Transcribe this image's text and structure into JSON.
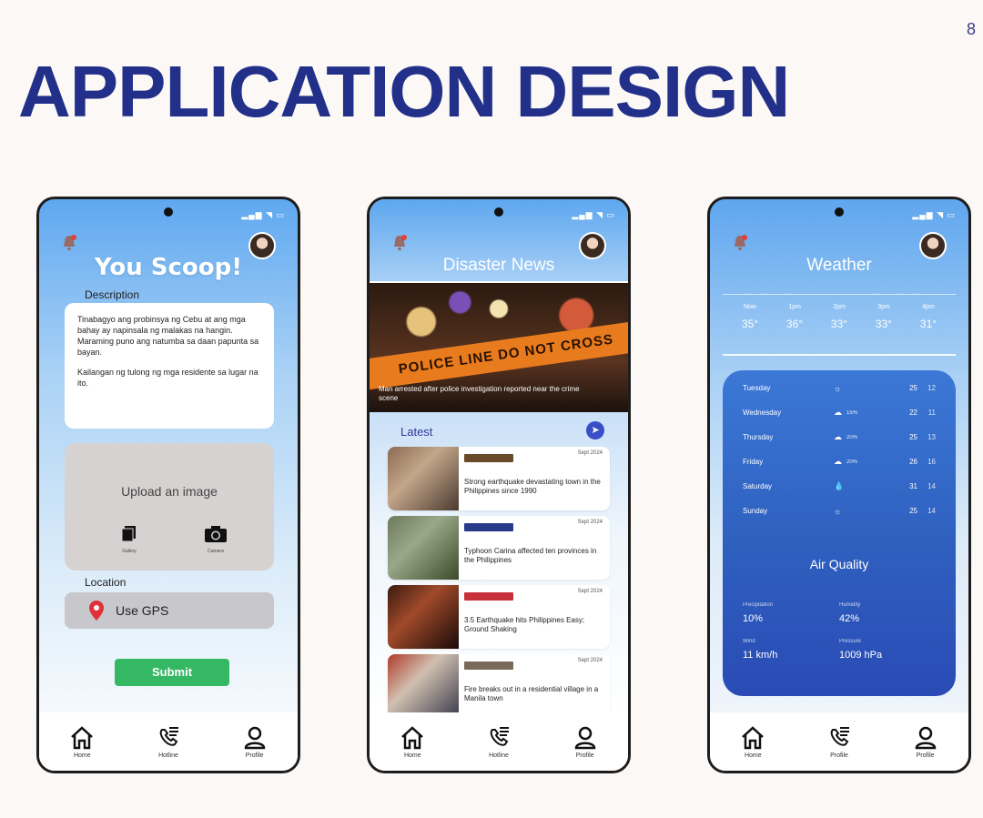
{
  "page_number": "8",
  "slide_title": "APPLICATION DESIGN",
  "nav": {
    "home": "Home",
    "hotline": "Hotline",
    "profile": "Profile"
  },
  "phone1": {
    "title": "You Scoop!",
    "description_label": "Description",
    "description_text_1": "Tinabagyo ang probinsya ng Cebu at ang mga bahay ay napinsala ng malakas na hangin. Maraming puno ang natumba sa daan papunta sa bayan.",
    "description_text_2": "Kailangan ng tulong ng mga residente sa lugar na ito.",
    "upload_label": "Upload an image",
    "gallery_label": "Gallery",
    "camera_label": "Camera",
    "location_label": "Location",
    "gps_label": "Use GPS",
    "submit_label": "Submit"
  },
  "phone2": {
    "title": "Disaster News",
    "hero_tape": "POLICE LINE DO NOT CROSS",
    "hero_caption": "Man arrested after police investigation reported near the crime scene",
    "latest_label": "Latest",
    "news": [
      {
        "tag_color": "#6b4a2a",
        "time": "Sept 2024",
        "text": "Strong earthquake devastating town in the Philippines since 1990",
        "thumb": "linear-gradient(135deg,#8a6a50,#c4a68a 40%,#4a3a30)"
      },
      {
        "tag_color": "#2a3a8a",
        "time": "Sept 2024",
        "text": "Typhoon Carina affected ten provinces in the Philippines",
        "thumb": "linear-gradient(135deg,#6c7a5a,#9aa88a 40%,#3a4a2a)"
      },
      {
        "tag_color": "#c8303a",
        "time": "Sept 2024",
        "text": "3.5 Earthquake hits Philippines Easy; Ground Shaking",
        "thumb": "linear-gradient(135deg,#3a1a10,#a04a2a 40%,#1a0a08)"
      },
      {
        "tag_color": "#7a6a5a",
        "time": "Sept 2024",
        "text": "Fire breaks out in a residential village in a Manila town",
        "thumb": "linear-gradient(135deg,#b03a2a,#d0c0b0 40%,#3a3a4a)"
      }
    ]
  },
  "phone3": {
    "title": "Weather",
    "hourly": [
      {
        "time": "Now",
        "temp": "35°"
      },
      {
        "time": "1pm",
        "temp": "36°"
      },
      {
        "time": "2pm",
        "temp": "33°"
      },
      {
        "time": "3pm",
        "temp": "33°"
      },
      {
        "time": "4pm",
        "temp": "31°"
      }
    ],
    "daily": [
      {
        "day": "Tuesday",
        "icon": "☼",
        "rain": "",
        "hi": "25",
        "lo": "12"
      },
      {
        "day": "Wednesday",
        "icon": "☁",
        "rain": "15%",
        "hi": "22",
        "lo": "11"
      },
      {
        "day": "Thursday",
        "icon": "☁",
        "rain": "20%",
        "hi": "25",
        "lo": "13"
      },
      {
        "day": "Friday",
        "icon": "☁",
        "rain": "20%",
        "hi": "26",
        "lo": "16"
      },
      {
        "day": "Saturday",
        "icon": "💧",
        "rain": "",
        "hi": "31",
        "lo": "14"
      },
      {
        "day": "Sunday",
        "icon": "☼",
        "rain": "",
        "hi": "25",
        "lo": "14"
      }
    ],
    "air_quality_title": "Air Quality",
    "metrics": [
      {
        "label": "Precipitation",
        "value": "10%"
      },
      {
        "label": "Humidity",
        "value": "42%"
      },
      {
        "label": "Wind",
        "value": "11 km/h"
      },
      {
        "label": "Pressure",
        "value": "1009 hPa"
      }
    ]
  }
}
